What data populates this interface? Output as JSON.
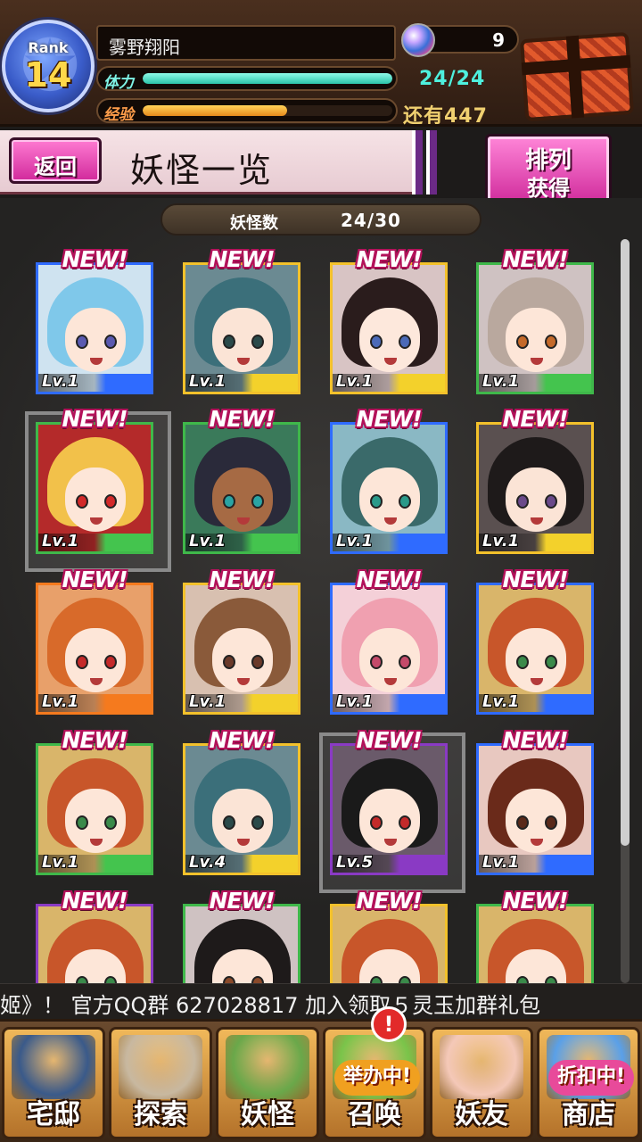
{
  "header": {
    "rank_label": "Rank",
    "rank_value": "14",
    "player_name": "雾野翔阳",
    "gems": "9",
    "stamina_label": "体力",
    "stamina_text": "24/24",
    "stamina_fraction": 1.0,
    "exp_label": "经验",
    "exp_text": "还有447",
    "exp_fraction": 0.58
  },
  "title_bar": {
    "back_label": "返回",
    "title": "妖怪一览",
    "sort_line1": "排列",
    "sort_line2": "获得"
  },
  "collection": {
    "count_label": "妖怪数",
    "count_value": "24/30"
  },
  "cards": [
    {
      "new": "NEW!",
      "level": "Lv.1",
      "frame": "#2f6bff",
      "strip": "#2f6bff",
      "hair": "#7fc8ea",
      "skin": "#fde6d8",
      "eye": "#5a5ab0",
      "bg": "#cfe3f0"
    },
    {
      "new": "NEW!",
      "level": "Lv.1",
      "frame": "#f3c12b",
      "strip": "#f3d12b",
      "hair": "#3b6f7a",
      "skin": "#fbe4d6",
      "eye": "#2a4a4a",
      "bg": "#6b8a92"
    },
    {
      "new": "NEW!",
      "level": "Lv.1",
      "frame": "#f3c12b",
      "strip": "#f3d12b",
      "hair": "#2a1c1c",
      "skin": "#fde8dc",
      "eye": "#4a6ab8",
      "bg": "#d8c4c4"
    },
    {
      "new": "NEW!",
      "level": "Lv.1",
      "frame": "#3fb84a",
      "strip": "#44c44e",
      "hair": "#b9a89e",
      "skin": "#fde6d8",
      "eye": "#c46a2a",
      "bg": "#cfc2c2"
    },
    {
      "new": "NEW!",
      "level": "Lv.1",
      "frame": "#3fb84a",
      "strip": "#44c44e",
      "hair": "#f2c14a",
      "skin": "#fde6d8",
      "eye": "#d22a2a",
      "bg": "#b42a2a",
      "selected": true
    },
    {
      "new": "NEW!",
      "level": "Lv.1",
      "frame": "#3fb84a",
      "strip": "#44c44e",
      "hair": "#2a2a3a",
      "skin": "#a66a44",
      "eye": "#2aa4a4",
      "bg": "#3a7a5a"
    },
    {
      "new": "NEW!",
      "level": "Lv.1",
      "frame": "#2f6bff",
      "strip": "#2f6bff",
      "hair": "#3a6a6a",
      "skin": "#fde6d8",
      "eye": "#2a9a8a",
      "bg": "#8ab8c4"
    },
    {
      "new": "NEW!",
      "level": "Lv.1",
      "frame": "#f3c12b",
      "strip": "#f3d12b",
      "hair": "#1e1a1a",
      "skin": "#fbe4d6",
      "eye": "#6a4a8a",
      "bg": "#5a5050"
    },
    {
      "new": "NEW!",
      "level": "Lv.1",
      "frame": "#f57a1e",
      "strip": "#f57a1e",
      "hair": "#d86a2a",
      "skin": "#fde6d8",
      "eye": "#c42a2a",
      "bg": "#e8a06a"
    },
    {
      "new": "NEW!",
      "level": "Lv.1",
      "frame": "#f3c12b",
      "strip": "#f3d12b",
      "hair": "#8a5a3a",
      "skin": "#fde6d8",
      "eye": "#6a3a2a",
      "bg": "#d8c0b0"
    },
    {
      "new": "NEW!",
      "level": "Lv.1",
      "frame": "#2f6bff",
      "strip": "#2f6bff",
      "hair": "#f0a0b0",
      "skin": "#fde6d8",
      "eye": "#c44a6a",
      "bg": "#f4d0d8"
    },
    {
      "new": "NEW!",
      "level": "Lv.1",
      "frame": "#2f6bff",
      "strip": "#2f6bff",
      "hair": "#c8562a",
      "skin": "#fde6d8",
      "eye": "#3a8a4a",
      "bg": "#d9b56a"
    },
    {
      "new": "NEW!",
      "level": "Lv.1",
      "frame": "#3fb84a",
      "strip": "#44c44e",
      "hair": "#c8562a",
      "skin": "#fde6d8",
      "eye": "#3a8a4a",
      "bg": "#d9b56a"
    },
    {
      "new": "NEW!",
      "level": "Lv.4",
      "frame": "#f3c12b",
      "strip": "#f3d12b",
      "hair": "#3b6f7a",
      "skin": "#fbe4d6",
      "eye": "#2a4a4a",
      "bg": "#6b8a92"
    },
    {
      "new": "NEW!",
      "level": "Lv.5",
      "frame": "#8a3ac4",
      "strip": "#8a3ac4",
      "hair": "#1a1a1a",
      "skin": "#fde6d8",
      "eye": "#c42a2a",
      "bg": "#6a5a6a",
      "selected": true
    },
    {
      "new": "NEW!",
      "level": "Lv.1",
      "frame": "#2f6bff",
      "strip": "#2f6bff",
      "hair": "#6a2a1a",
      "skin": "#fde6d8",
      "eye": "#5a2a1a",
      "bg": "#e8c8c0"
    },
    {
      "new": "NEW!",
      "level": "",
      "frame": "#8a3ac4",
      "strip": "#8a3ac4",
      "hair": "#c8562a",
      "skin": "#fde6d8",
      "eye": "#3a8a4a",
      "bg": "#d9b56a"
    },
    {
      "new": "NEW!",
      "level": "",
      "frame": "#3fb84a",
      "strip": "#44c44e",
      "hair": "#1e1a1a",
      "skin": "#fde6d8",
      "eye": "#8a4a2a",
      "bg": "#cfc2c2"
    },
    {
      "new": "NEW!",
      "level": "",
      "frame": "#f3c12b",
      "strip": "#f3d12b",
      "hair": "#c8562a",
      "skin": "#fde6d8",
      "eye": "#3a8a4a",
      "bg": "#d9b56a"
    },
    {
      "new": "NEW!",
      "level": "",
      "frame": "#3fb84a",
      "strip": "#44c44e",
      "hair": "#c8562a",
      "skin": "#fde6d8",
      "eye": "#3a8a4a",
      "bg": "#d9b56a"
    }
  ],
  "ticker": {
    "text": "姬》！ 官方QQ群 627028817   加入领取５灵玉加群礼包"
  },
  "bottom_nav": [
    {
      "label": "宅邸",
      "icon": "mansion-icon",
      "art": "#3a5a8a"
    },
    {
      "label": "探索",
      "icon": "magnifier-icon",
      "art": "#c8b8a0"
    },
    {
      "label": "妖怪",
      "icon": "scroll-icon",
      "art": "#6aa84a"
    },
    {
      "label": "召唤",
      "icon": "summon-icon",
      "art": "#7ac44a",
      "badge": "举办中!",
      "badge_color": "#f0a020"
    },
    {
      "label": "妖友",
      "icon": "catgirl-icon",
      "art": "#f4c8b8"
    },
    {
      "label": "商店",
      "icon": "crystal-ball-icon",
      "art": "#5aa0e8",
      "badge": "折扣中!",
      "badge_color": "#e84a9a"
    }
  ],
  "nav_alert": "!"
}
